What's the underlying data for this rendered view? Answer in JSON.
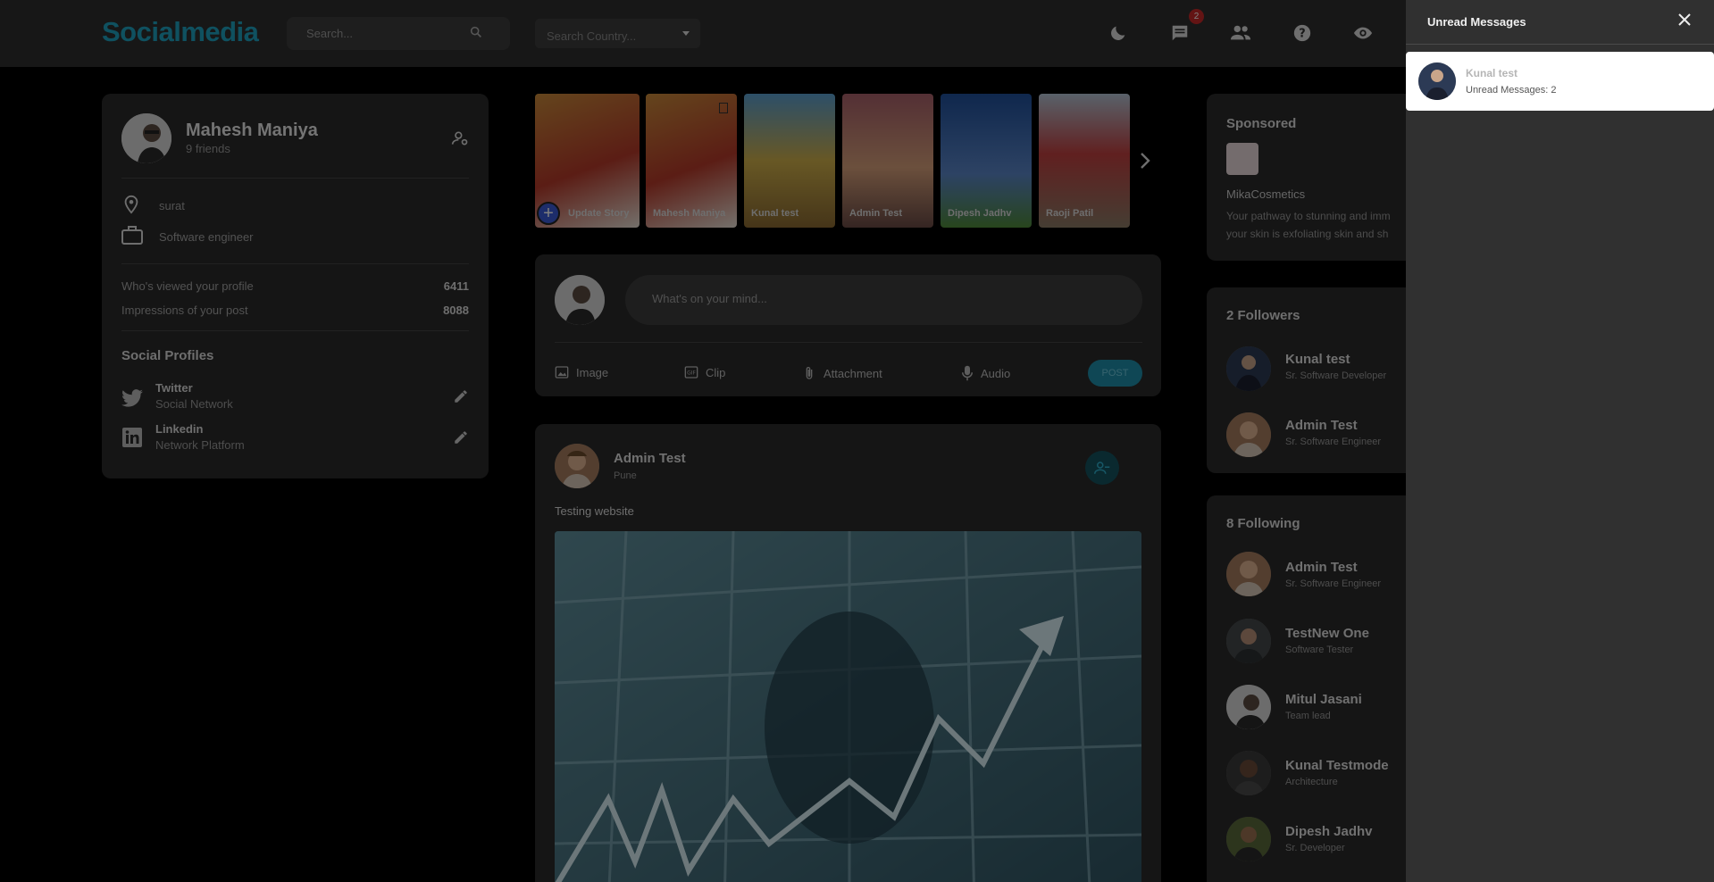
{
  "nav": {
    "brand": "Socialmedia",
    "search_placeholder": "Search...",
    "country_placeholder": "Search Country...",
    "messages_badge": "2",
    "icons": [
      "moon-icon",
      "chat-icon",
      "people-icon",
      "help-icon",
      "eye-icon"
    ]
  },
  "profile": {
    "name": "Mahesh Maniya",
    "friends": "9 friends",
    "location": "surat",
    "occupation": "Software engineer",
    "stats": [
      {
        "label": "Who's viewed your profile",
        "value": "6411"
      },
      {
        "label": "Impressions of your post",
        "value": "8088"
      }
    ],
    "social_title": "Social Profiles",
    "socials": [
      {
        "name": "Twitter",
        "sub": "Social Network"
      },
      {
        "name": "Linkedin",
        "sub": "Network Platform"
      }
    ]
  },
  "stories": [
    {
      "label": "Update Story"
    },
    {
      "label": "Mahesh Maniya"
    },
    {
      "label": "Kunal test"
    },
    {
      "label": "Admin Test"
    },
    {
      "label": "Dipesh Jadhv"
    },
    {
      "label": "Raoji Patil"
    }
  ],
  "composer": {
    "placeholder": "What's on your mind...",
    "actions": [
      "Image",
      "Clip",
      "Attachment",
      "Audio"
    ],
    "post_label": "POST"
  },
  "post": {
    "author": "Admin Test",
    "location": "Pune",
    "text": "Testing website"
  },
  "sponsored": {
    "title": "Sponsored",
    "brand": "MikaCosmetics",
    "text_line1": "Your pathway to stunning and imm",
    "text_line2": "your skin is exfoliating skin and sh"
  },
  "followers": {
    "title": "2 Followers",
    "items": [
      {
        "name": "Kunal test",
        "role": "Sr. Software Developer"
      },
      {
        "name": "Admin Test",
        "role": "Sr. Software Engineer"
      }
    ]
  },
  "following": {
    "title": "8 Following",
    "items": [
      {
        "name": "Admin Test",
        "role": "Sr. Software Engineer"
      },
      {
        "name": "TestNew One",
        "role": "Software Tester"
      },
      {
        "name": "Mitul Jasani",
        "role": "Team lead"
      },
      {
        "name": "Kunal Testmode",
        "role": "Architecture"
      },
      {
        "name": "Dipesh Jadhv",
        "role": "Sr. Developer"
      }
    ]
  },
  "drawer": {
    "title": "Unread Messages",
    "message": {
      "name": "Kunal test",
      "count_text": "Unread Messages: 2"
    }
  }
}
